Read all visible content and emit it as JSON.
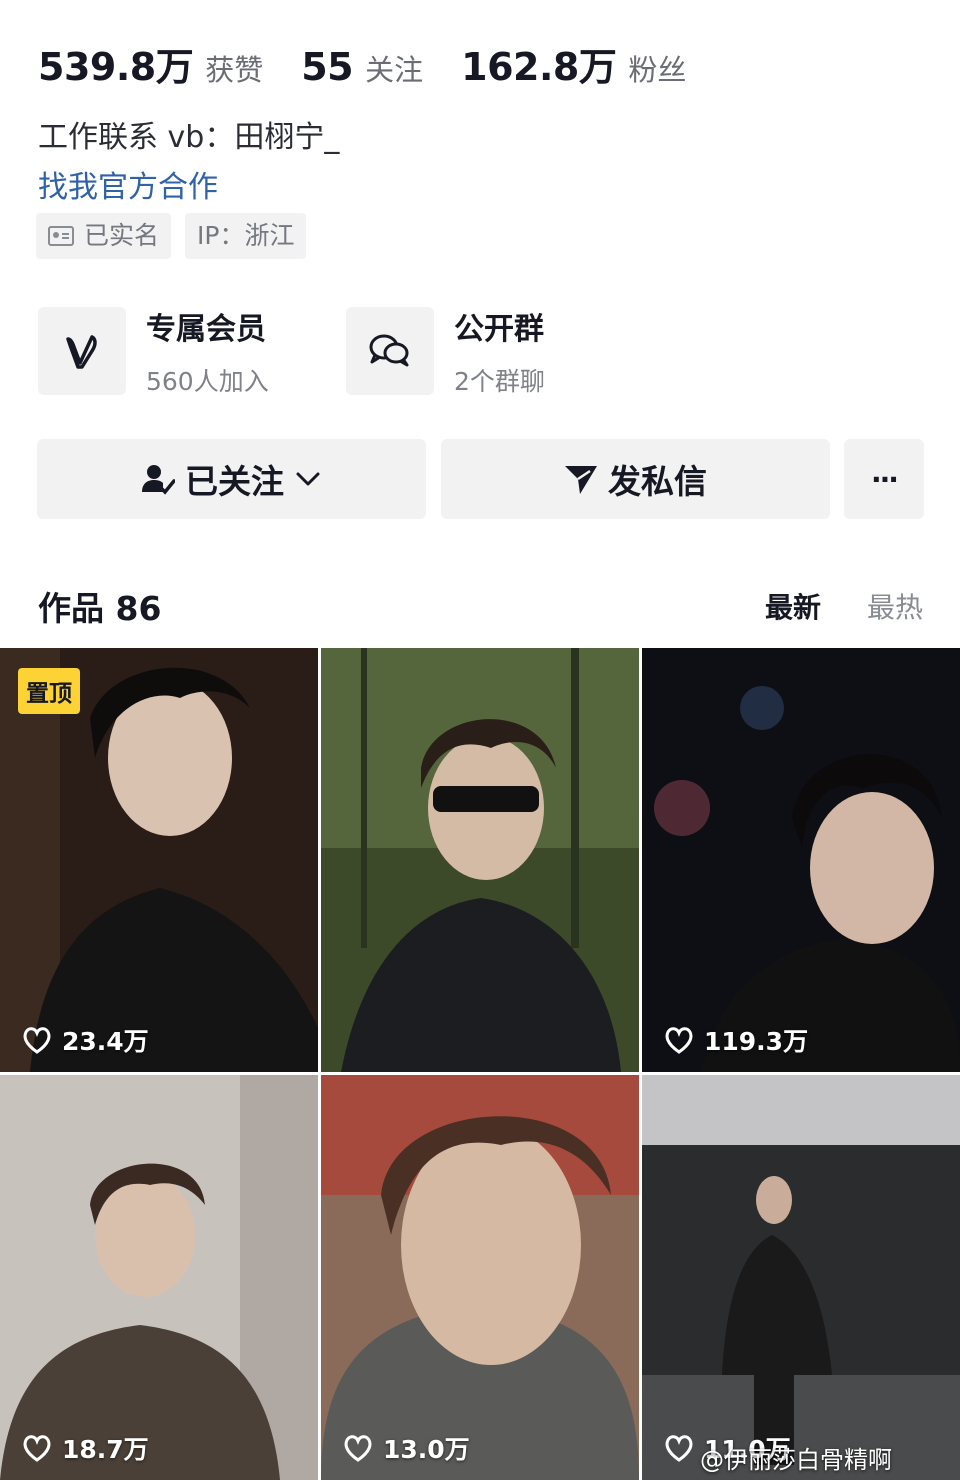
{
  "stats": [
    {
      "value": "539.8万",
      "label": "获赞"
    },
    {
      "value": "55",
      "label": "关注"
    },
    {
      "value": "162.8万",
      "label": "粉丝"
    }
  ],
  "bio": "工作联系 vb：田栩宁_",
  "coop_link": "找我官方合作",
  "tags": [
    "已实名",
    "IP：浙江"
  ],
  "features": [
    {
      "title": "专属会员",
      "subtitle": "560人加入",
      "icon": "v-logo-icon"
    },
    {
      "title": "公开群",
      "subtitle": "2个群聊",
      "icon": "group-chat-icon"
    }
  ],
  "actions": {
    "follow_label": "已关注",
    "message_label": "发私信",
    "more_label": "···"
  },
  "works": {
    "title": "作品 86",
    "sort_new": "最新",
    "sort_hot": "最热",
    "pin_label": "置顶",
    "items": [
      {
        "likes": "23.4万",
        "pinned": true
      },
      {
        "likes": "",
        "pinned": false
      },
      {
        "likes": "119.3万",
        "pinned": false
      },
      {
        "likes": "18.7万",
        "pinned": false
      },
      {
        "likes": "13.0万",
        "pinned": false
      },
      {
        "likes": "11.0万",
        "pinned": false
      }
    ]
  },
  "watermark": "@伊丽莎白骨精啊",
  "colors": {
    "accent_link": "#2f62a8",
    "pin_badge": "#fdd235",
    "button_bg": "#f2f2f3"
  }
}
